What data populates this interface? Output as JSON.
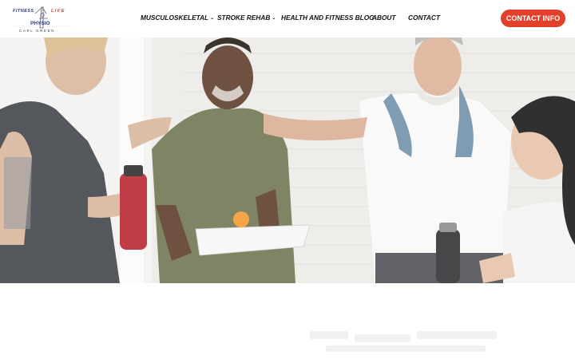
{
  "logo": {
    "left_word": "FITNESS",
    "right_word": "LIFE",
    "center_word": "PHYSIO",
    "name": "CARL GREEN"
  },
  "nav": {
    "items": [
      {
        "label": "MUSCULOSKELETAL",
        "has_dropdown": true
      },
      {
        "label": "STROKE REHAB",
        "has_dropdown": true
      },
      {
        "label": "HEALTH AND FITNESS BLOG",
        "has_dropdown": false
      },
      {
        "label": "ABOUT",
        "has_dropdown": false
      },
      {
        "label": "CONTACT",
        "has_dropdown": false
      }
    ],
    "dropdown_glyph": "⌄"
  },
  "cta": {
    "label": "CONTACT INFO",
    "color": "#e2402b"
  },
  "hero": {
    "image_subject": "group of smiling people at a fitness class"
  },
  "colors": {
    "brand_blue": "#2b3a8f",
    "brand_red": "#d23a2a",
    "accent": "#e2402b"
  }
}
